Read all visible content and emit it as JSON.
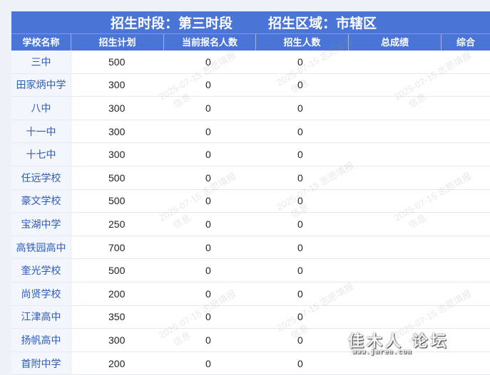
{
  "top_strip_text": "",
  "title": {
    "period": "招生时段：第三时段",
    "area": "招生区域：市辖区"
  },
  "columns": [
    "学校名称",
    "招生计划",
    "当前报名人数",
    "招生人数",
    "总成绩",
    "综合"
  ],
  "rows": [
    {
      "name": "三中",
      "plan": "500",
      "current": "0",
      "admitted": "0"
    },
    {
      "name": "田家炳中学",
      "plan": "300",
      "current": "0",
      "admitted": "0"
    },
    {
      "name": "八中",
      "plan": "300",
      "current": "0",
      "admitted": "0"
    },
    {
      "name": "十一中",
      "plan": "300",
      "current": "0",
      "admitted": "0"
    },
    {
      "name": "十七中",
      "plan": "300",
      "current": "0",
      "admitted": "0"
    },
    {
      "name": "任远学校",
      "plan": "500",
      "current": "0",
      "admitted": "0"
    },
    {
      "name": "豪文学校",
      "plan": "500",
      "current": "0",
      "admitted": "0"
    },
    {
      "name": "宝湖中学",
      "plan": "250",
      "current": "0",
      "admitted": "0"
    },
    {
      "name": "高铁园高中",
      "plan": "700",
      "current": "0",
      "admitted": "0"
    },
    {
      "name": "奎光学校",
      "plan": "500",
      "current": "0",
      "admitted": "0"
    },
    {
      "name": "尚贤学校",
      "plan": "200",
      "current": "0",
      "admitted": "0"
    },
    {
      "name": "江津高中",
      "plan": "350",
      "current": "0",
      "admitted": "0"
    },
    {
      "name": "扬帆高中",
      "plan": "300",
      "current": "0",
      "admitted": "0"
    },
    {
      "name": "首附中学",
      "plan": "200",
      "current": "0",
      "admitted": "0"
    }
  ],
  "watermark": {
    "date": "2025-07-15 志愿填报",
    "sub": "信息"
  },
  "corner_logo": {
    "main": "佳木人 论坛",
    "sub": "www.jmren.com"
  }
}
